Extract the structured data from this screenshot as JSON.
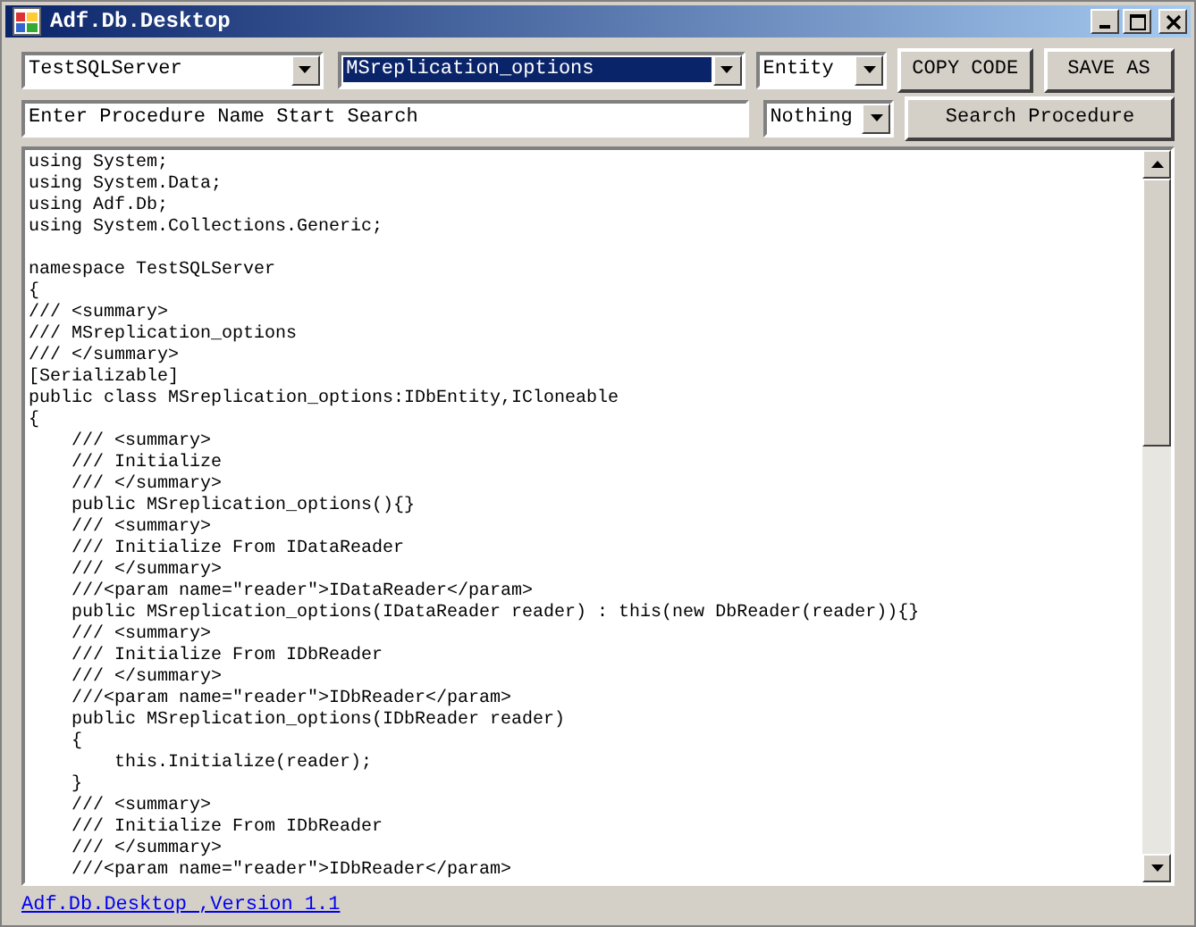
{
  "window": {
    "title": "Adf.Db.Desktop"
  },
  "toolbar": {
    "dropdowns": [
      {
        "value": "TestSQLServer",
        "highlighted": false
      },
      {
        "value": "MSreplication_options",
        "highlighted": true
      },
      {
        "value": "Entity",
        "highlighted": false
      }
    ],
    "buttons": [
      "COPY CODE",
      "SAVE AS"
    ]
  },
  "search": {
    "value": "Enter Procedure Name Start Search",
    "dropdown": {
      "value": "Nothing",
      "highlighted": false
    },
    "button": "Search Procedure"
  },
  "code": {
    "blocks": [
      [
        "using System;",
        "using System.Data;",
        "using Adf.Db;",
        "using System.Collections.Generic;"
      ],
      [
        "namespace TestSQLServer",
        "{",
        "/// <summary>",
        "/// MSreplication_options",
        "/// </summary>",
        "[Serializable]",
        "public class MSreplication_options:IDbEntity,ICloneable",
        "{",
        "    /// <summary>",
        "    /// Initialize",
        "    /// </summary>",
        "    public MSreplication_options(){}",
        "    /// <summary>",
        "    /// Initialize From IDataReader",
        "    /// </summary>",
        "    ///<param name=\"reader\">IDataReader</param>",
        "    public MSreplication_options(IDataReader reader) : this(new DbReader(reader)){}",
        "    /// <summary>",
        "    /// Initialize From IDbReader",
        "    /// </summary>",
        "    ///<param name=\"reader\">IDbReader</param>",
        "    public MSreplication_options(IDbReader reader)",
        "    {",
        "        this.Initialize(reader);",
        "    }",
        "    /// <summary>",
        "    /// Initialize From IDbReader",
        "    /// </summary>",
        "    ///<param name=\"reader\">IDbReader</param>"
      ]
    ]
  },
  "status_bar": {
    "link": "Adf.Db.Desktop ,Version 1.1"
  }
}
